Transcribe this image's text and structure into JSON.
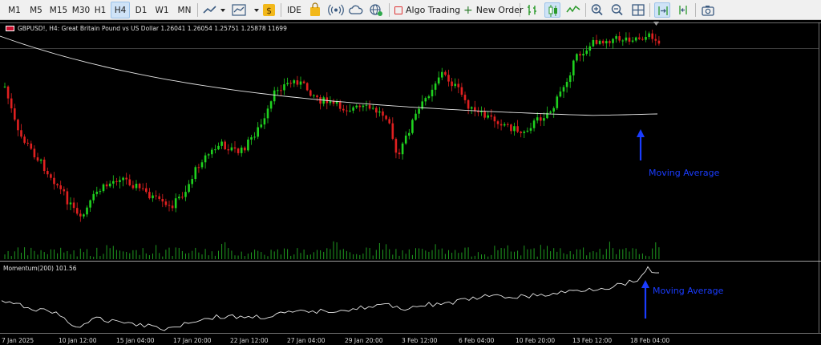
{
  "toolbar": {
    "timeframes": [
      {
        "label": "M1",
        "active": false
      },
      {
        "label": "M5",
        "active": false
      },
      {
        "label": "M15",
        "active": false
      },
      {
        "label": "M30",
        "active": false
      },
      {
        "label": "H1",
        "active": false
      },
      {
        "label": "H4",
        "active": true
      },
      {
        "label": "D1",
        "active": false
      },
      {
        "label": "W1",
        "active": false
      },
      {
        "label": "MN",
        "active": false
      }
    ],
    "ide_label": "IDE",
    "algo_trading_label": "Algo Trading",
    "new_order_label": "New Order"
  },
  "chart": {
    "info_line": "GBPUSD!, H4:  Great Britain Pound vs US Dollar  1.26041 1.26054 1.25751 1.25878  11699",
    "indicator_label": "Momentum(200) 101.56",
    "annotation_main": "Moving Average",
    "annotation_indicator": "Moving Average",
    "x_ticks": [
      "7 Jan 2025",
      "10 Jan 12:00",
      "15 Jan 04:00",
      "17 Jan 20:00",
      "22 Jan 12:00",
      "27 Jan 04:00",
      "29 Jan 20:00",
      "3 Feb 12:00",
      "6 Feb 04:00",
      "10 Feb 20:00",
      "13 Feb 12:00",
      "18 Feb 04:00"
    ],
    "colors": {
      "bull": "#1fd11f",
      "bear": "#e02020",
      "ma": "#e8e8e8",
      "annotation": "#1a3cff",
      "separator": "#cccccc"
    }
  }
}
